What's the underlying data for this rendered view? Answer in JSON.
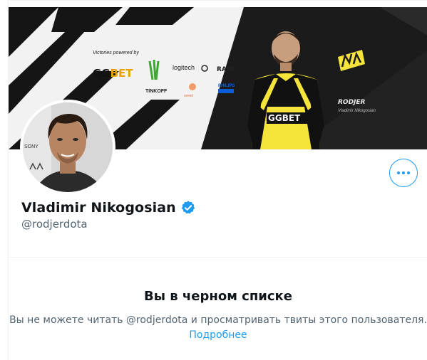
{
  "profile": {
    "display_name": "Vladimir Nikogosian",
    "handle": "@rodjerdota",
    "verified_label": "Verified account"
  },
  "banner": {
    "victories_text": "Victories powered by",
    "sponsors": {
      "ggbet": "GGBET",
      "logitech": "logitech",
      "raid": "RAID",
      "tinkoff": "TINKOFF",
      "philips": "PHILIPS"
    },
    "player_tag": "RODJER",
    "player_name": "Vladimir Nikogosian",
    "jersey_text": "GGBET",
    "team_logo": "NAVI"
  },
  "avatar_watermark": "SONY",
  "actions": {
    "more_label": "More"
  },
  "blocked": {
    "title": "Вы в черном списке",
    "message": "Вы не можете читать @rodjerdota и просматривать твиты этого пользователя.",
    "learn_more": "Подробнее"
  },
  "colors": {
    "accent": "#1d9bf0",
    "text_primary": "#0f1419",
    "text_secondary": "#536471",
    "divider": "#eff3f4",
    "navi_yellow": "#f5e43a"
  },
  "icons": {
    "more": "more-dots-icon",
    "verified": "verified-badge-icon"
  }
}
